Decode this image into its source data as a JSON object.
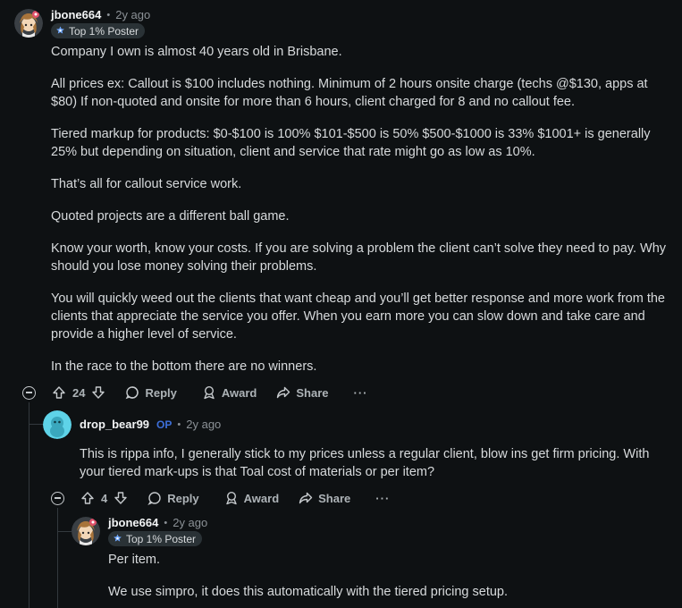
{
  "comment1": {
    "username": "jbone664",
    "time": "2y ago",
    "flair": "Top 1% Poster",
    "paragraphs": [
      "Company I own is almost 40 years old in Brisbane.",
      "All prices ex: Callout is $100 includes nothing. Minimum of 2 hours onsite charge (techs @$130, apps at $80) If non-quoted and onsite for more than 6 hours, client charged for 8 and no callout fee.",
      "Tiered markup for products: $0-$100 is 100% $101-$500 is 50% $500-$1000 is 33% $1001+ is generally 25% but depending on situation, client and service that rate might go as low as 10%.",
      "That’s all for callout service work.",
      "Quoted projects are a different ball game.",
      "Know your worth, know your costs. If you are solving a problem the client can’t solve they need to pay. Why should you lose money solving their problems.",
      "You will quickly weed out the clients that want cheap and you’ll get better response and more work from the clients that appreciate the service you offer. When you earn more you can slow down and take care and provide a higher level of service.",
      "In the race to the bottom there are no winners."
    ],
    "votes": "24",
    "reply": "Reply",
    "award": "Award",
    "share": "Share",
    "more": "···"
  },
  "comment2": {
    "username": "drop_bear99",
    "op": "OP",
    "time": "2y ago",
    "paragraphs": [
      "This is rippa info, I generally stick to my prices unless a regular client, blow ins get firm pricing. With your tiered mark-ups is that Toal cost of materials or per item?"
    ],
    "votes": "4",
    "reply": "Reply",
    "award": "Award",
    "share": "Share",
    "more": "···"
  },
  "comment3": {
    "username": "jbone664",
    "time": "2y ago",
    "flair": "Top 1% Poster",
    "paragraphs": [
      "Per item.",
      "We use simpro, it does this automatically with the tiered pricing setup."
    ]
  },
  "separator": "•",
  "colors": {
    "background": "#0e1113",
    "text": "#d7dadc",
    "muted": "#8b9196",
    "op": "#3d6fd9",
    "thread_line": "#33393e"
  },
  "icons": [
    "collapse-icon",
    "upvote-icon",
    "downvote-icon",
    "reply-icon",
    "award-icon",
    "share-icon",
    "overflow-icon",
    "flair-badge-icon"
  ]
}
